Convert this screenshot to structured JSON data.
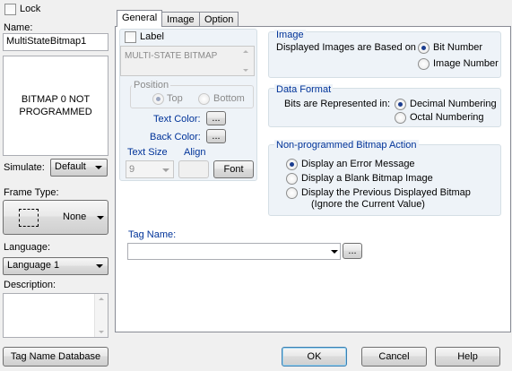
{
  "left": {
    "lock_label": "Lock",
    "name_label": "Name:",
    "name_value": "MultiStateBitmap1",
    "preview_text": "BITMAP 0 NOT PROGRAMMED",
    "simulate_label": "Simulate:",
    "simulate_value": "Default",
    "frame_type_label": "Frame Type:",
    "frame_type_value": "None",
    "language_label": "Language:",
    "language_value": "Language 1",
    "description_label": "Description:",
    "description_value": "",
    "tag_db_button": "Tag Name Database"
  },
  "tabs": [
    {
      "label": "General",
      "active": true
    },
    {
      "label": "Image",
      "active": false
    },
    {
      "label": "Option",
      "active": false
    }
  ],
  "general": {
    "label_checkbox": "Label",
    "label_text": "MULTI-STATE BITMAP",
    "position_title": "Position",
    "position_top": "Top",
    "position_bottom": "Bottom",
    "text_color_label": "Text Color:",
    "back_color_label": "Back Color:",
    "color_button": "...",
    "text_size_label": "Text Size",
    "text_size_value": "9",
    "align_label": "Align",
    "font_button": "Font",
    "image_group_title": "Image",
    "image_based_label": "Displayed Images are Based on",
    "image_opt_bit": "Bit Number",
    "image_opt_image": "Image Number",
    "data_format_title": "Data Format",
    "bits_label": "Bits are Represented in:",
    "format_decimal": "Decimal Numbering",
    "format_octal": "Octal Numbering",
    "np_title": "Non-programmed Bitmap Action",
    "np_opt1": "Display an Error Message",
    "np_opt2": "Display a Blank Bitmap Image",
    "np_opt3_line1": "Display the Previous Displayed Bitmap",
    "np_opt3_line2": "(Ignore the Current Value)",
    "tag_name_label": "Tag Name:",
    "tag_name_value": "",
    "tag_browse_button": "..."
  },
  "footer": {
    "ok": "OK",
    "cancel": "Cancel",
    "help": "Help"
  }
}
